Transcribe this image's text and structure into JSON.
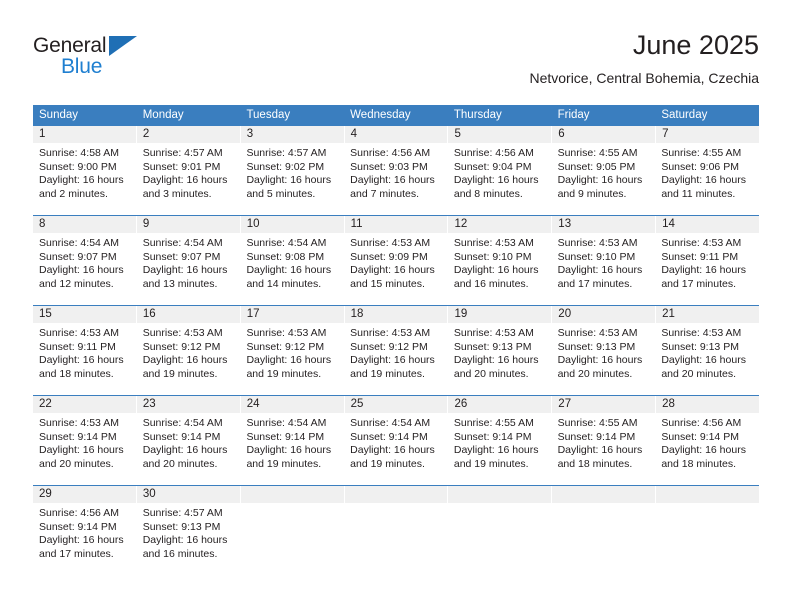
{
  "brand": {
    "name_top": "General",
    "name_bottom": "Blue",
    "triangle_color": "#1f6fb5",
    "blue_color": "#1f7fd0"
  },
  "header": {
    "title": "June 2025",
    "subtitle": "Netvorice, Central Bohemia, Czechia"
  },
  "theme": {
    "header_bg": "#3a7ebf",
    "daynum_bg": "#f0f0f0",
    "text": "#231f20"
  },
  "weekdays": [
    "Sunday",
    "Monday",
    "Tuesday",
    "Wednesday",
    "Thursday",
    "Friday",
    "Saturday"
  ],
  "weeks": [
    {
      "days": [
        {
          "num": "1",
          "sunrise": "Sunrise: 4:58 AM",
          "sunset": "Sunset: 9:00 PM",
          "daylight1": "Daylight: 16 hours",
          "daylight2": "and 2 minutes."
        },
        {
          "num": "2",
          "sunrise": "Sunrise: 4:57 AM",
          "sunset": "Sunset: 9:01 PM",
          "daylight1": "Daylight: 16 hours",
          "daylight2": "and 3 minutes."
        },
        {
          "num": "3",
          "sunrise": "Sunrise: 4:57 AM",
          "sunset": "Sunset: 9:02 PM",
          "daylight1": "Daylight: 16 hours",
          "daylight2": "and 5 minutes."
        },
        {
          "num": "4",
          "sunrise": "Sunrise: 4:56 AM",
          "sunset": "Sunset: 9:03 PM",
          "daylight1": "Daylight: 16 hours",
          "daylight2": "and 7 minutes."
        },
        {
          "num": "5",
          "sunrise": "Sunrise: 4:56 AM",
          "sunset": "Sunset: 9:04 PM",
          "daylight1": "Daylight: 16 hours",
          "daylight2": "and 8 minutes."
        },
        {
          "num": "6",
          "sunrise": "Sunrise: 4:55 AM",
          "sunset": "Sunset: 9:05 PM",
          "daylight1": "Daylight: 16 hours",
          "daylight2": "and 9 minutes."
        },
        {
          "num": "7",
          "sunrise": "Sunrise: 4:55 AM",
          "sunset": "Sunset: 9:06 PM",
          "daylight1": "Daylight: 16 hours",
          "daylight2": "and 11 minutes."
        }
      ]
    },
    {
      "days": [
        {
          "num": "8",
          "sunrise": "Sunrise: 4:54 AM",
          "sunset": "Sunset: 9:07 PM",
          "daylight1": "Daylight: 16 hours",
          "daylight2": "and 12 minutes."
        },
        {
          "num": "9",
          "sunrise": "Sunrise: 4:54 AM",
          "sunset": "Sunset: 9:07 PM",
          "daylight1": "Daylight: 16 hours",
          "daylight2": "and 13 minutes."
        },
        {
          "num": "10",
          "sunrise": "Sunrise: 4:54 AM",
          "sunset": "Sunset: 9:08 PM",
          "daylight1": "Daylight: 16 hours",
          "daylight2": "and 14 minutes."
        },
        {
          "num": "11",
          "sunrise": "Sunrise: 4:53 AM",
          "sunset": "Sunset: 9:09 PM",
          "daylight1": "Daylight: 16 hours",
          "daylight2": "and 15 minutes."
        },
        {
          "num": "12",
          "sunrise": "Sunrise: 4:53 AM",
          "sunset": "Sunset: 9:10 PM",
          "daylight1": "Daylight: 16 hours",
          "daylight2": "and 16 minutes."
        },
        {
          "num": "13",
          "sunrise": "Sunrise: 4:53 AM",
          "sunset": "Sunset: 9:10 PM",
          "daylight1": "Daylight: 16 hours",
          "daylight2": "and 17 minutes."
        },
        {
          "num": "14",
          "sunrise": "Sunrise: 4:53 AM",
          "sunset": "Sunset: 9:11 PM",
          "daylight1": "Daylight: 16 hours",
          "daylight2": "and 17 minutes."
        }
      ]
    },
    {
      "days": [
        {
          "num": "15",
          "sunrise": "Sunrise: 4:53 AM",
          "sunset": "Sunset: 9:11 PM",
          "daylight1": "Daylight: 16 hours",
          "daylight2": "and 18 minutes."
        },
        {
          "num": "16",
          "sunrise": "Sunrise: 4:53 AM",
          "sunset": "Sunset: 9:12 PM",
          "daylight1": "Daylight: 16 hours",
          "daylight2": "and 19 minutes."
        },
        {
          "num": "17",
          "sunrise": "Sunrise: 4:53 AM",
          "sunset": "Sunset: 9:12 PM",
          "daylight1": "Daylight: 16 hours",
          "daylight2": "and 19 minutes."
        },
        {
          "num": "18",
          "sunrise": "Sunrise: 4:53 AM",
          "sunset": "Sunset: 9:12 PM",
          "daylight1": "Daylight: 16 hours",
          "daylight2": "and 19 minutes."
        },
        {
          "num": "19",
          "sunrise": "Sunrise: 4:53 AM",
          "sunset": "Sunset: 9:13 PM",
          "daylight1": "Daylight: 16 hours",
          "daylight2": "and 20 minutes."
        },
        {
          "num": "20",
          "sunrise": "Sunrise: 4:53 AM",
          "sunset": "Sunset: 9:13 PM",
          "daylight1": "Daylight: 16 hours",
          "daylight2": "and 20 minutes."
        },
        {
          "num": "21",
          "sunrise": "Sunrise: 4:53 AM",
          "sunset": "Sunset: 9:13 PM",
          "daylight1": "Daylight: 16 hours",
          "daylight2": "and 20 minutes."
        }
      ]
    },
    {
      "days": [
        {
          "num": "22",
          "sunrise": "Sunrise: 4:53 AM",
          "sunset": "Sunset: 9:14 PM",
          "daylight1": "Daylight: 16 hours",
          "daylight2": "and 20 minutes."
        },
        {
          "num": "23",
          "sunrise": "Sunrise: 4:54 AM",
          "sunset": "Sunset: 9:14 PM",
          "daylight1": "Daylight: 16 hours",
          "daylight2": "and 20 minutes."
        },
        {
          "num": "24",
          "sunrise": "Sunrise: 4:54 AM",
          "sunset": "Sunset: 9:14 PM",
          "daylight1": "Daylight: 16 hours",
          "daylight2": "and 19 minutes."
        },
        {
          "num": "25",
          "sunrise": "Sunrise: 4:54 AM",
          "sunset": "Sunset: 9:14 PM",
          "daylight1": "Daylight: 16 hours",
          "daylight2": "and 19 minutes."
        },
        {
          "num": "26",
          "sunrise": "Sunrise: 4:55 AM",
          "sunset": "Sunset: 9:14 PM",
          "daylight1": "Daylight: 16 hours",
          "daylight2": "and 19 minutes."
        },
        {
          "num": "27",
          "sunrise": "Sunrise: 4:55 AM",
          "sunset": "Sunset: 9:14 PM",
          "daylight1": "Daylight: 16 hours",
          "daylight2": "and 18 minutes."
        },
        {
          "num": "28",
          "sunrise": "Sunrise: 4:56 AM",
          "sunset": "Sunset: 9:14 PM",
          "daylight1": "Daylight: 16 hours",
          "daylight2": "and 18 minutes."
        }
      ]
    },
    {
      "days": [
        {
          "num": "29",
          "sunrise": "Sunrise: 4:56 AM",
          "sunset": "Sunset: 9:14 PM",
          "daylight1": "Daylight: 16 hours",
          "daylight2": "and 17 minutes."
        },
        {
          "num": "30",
          "sunrise": "Sunrise: 4:57 AM",
          "sunset": "Sunset: 9:13 PM",
          "daylight1": "Daylight: 16 hours",
          "daylight2": "and 16 minutes."
        },
        {
          "num": "",
          "sunrise": "",
          "sunset": "",
          "daylight1": "",
          "daylight2": ""
        },
        {
          "num": "",
          "sunrise": "",
          "sunset": "",
          "daylight1": "",
          "daylight2": ""
        },
        {
          "num": "",
          "sunrise": "",
          "sunset": "",
          "daylight1": "",
          "daylight2": ""
        },
        {
          "num": "",
          "sunrise": "",
          "sunset": "",
          "daylight1": "",
          "daylight2": ""
        },
        {
          "num": "",
          "sunrise": "",
          "sunset": "",
          "daylight1": "",
          "daylight2": ""
        }
      ]
    }
  ]
}
